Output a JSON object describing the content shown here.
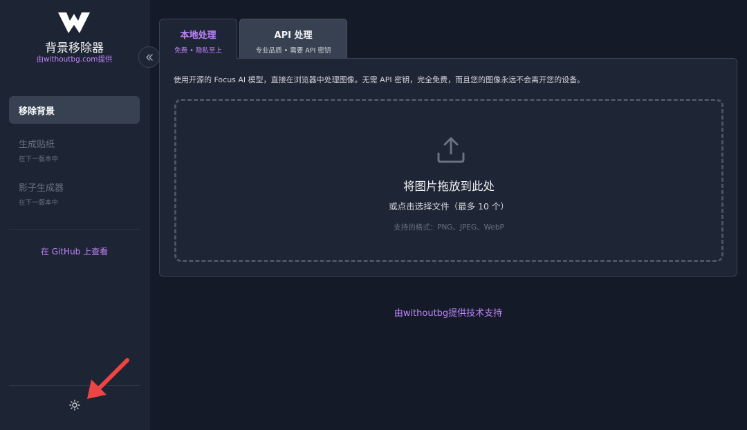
{
  "brand": {
    "title": "背景移除器",
    "subtitle_prefix": "由",
    "subtitle_link": "withoutbg.com",
    "subtitle_suffix": "提供"
  },
  "sidebar": {
    "collapse_icon": "double-chevron-left-icon",
    "items": [
      {
        "label": "移除背景",
        "sub": "",
        "active": true
      },
      {
        "label": "生成贴纸",
        "sub": "在下一版本中",
        "active": false
      },
      {
        "label": "影子生成器",
        "sub": "在下一版本中",
        "active": false
      }
    ],
    "github_link": "在 GitHub 上查看",
    "theme_icon": "sun-icon"
  },
  "tabs": [
    {
      "label": "本地处理",
      "sub": "免费 • 隐私至上",
      "active": true
    },
    {
      "label": "API 处理",
      "sub": "专业品质 • 需要 API 密钥",
      "active": false
    }
  ],
  "main": {
    "description": "使用开源的 Focus AI 模型，直接在浏览器中处理图像。无需 API 密钥，完全免费，而且您的图像永远不会离开您的设备。",
    "dropzone": {
      "icon": "upload-icon",
      "title": "将图片拖放到此处",
      "subtitle": "或点击选择文件（最多 10 个）",
      "formats": "支持的格式：PNG、JPEG、WebP"
    },
    "powered_by": "由withoutbg提供技术支持"
  },
  "colors": {
    "accent": "#c084fc",
    "background": "#141a28",
    "sidebar": "#1d2433",
    "panel": "#1e2534",
    "annotation_arrow": "#ef4444"
  }
}
